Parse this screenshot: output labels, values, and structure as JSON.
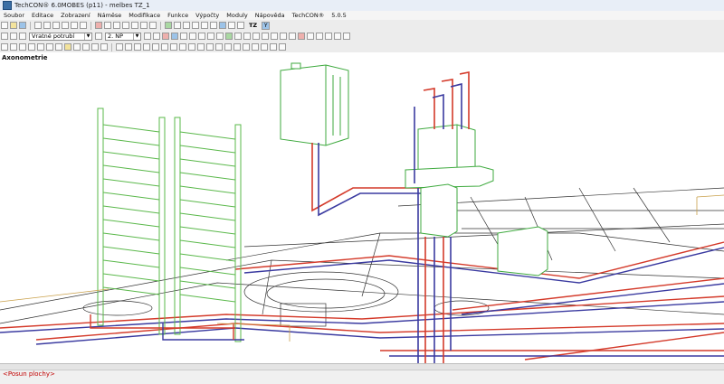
{
  "window": {
    "title": "TechCON® 6.0MOBES (p11) - melbes TZ_1"
  },
  "menu": [
    "Soubor",
    "Editace",
    "Zobrazení",
    "Náměse",
    "Modifikace",
    "Funkce",
    "Výpočty",
    "Moduly",
    "Nápověda",
    "TechCON®",
    "5.0.5"
  ],
  "toolbar": {
    "tz_label": "TZ",
    "y_label": "Y",
    "pipe_combo": "Vratné potrubí",
    "floor_combo": "2. NP"
  },
  "viewport": {
    "view_name": "Axonometrie"
  },
  "status": {
    "hint": "<Posun plochy>"
  },
  "colors": {
    "supply": "#d43a2a",
    "return": "#3a3aa0",
    "radiator": "#5ab84a",
    "boiler": "#3faa3f",
    "floor_lines": "#333333"
  }
}
